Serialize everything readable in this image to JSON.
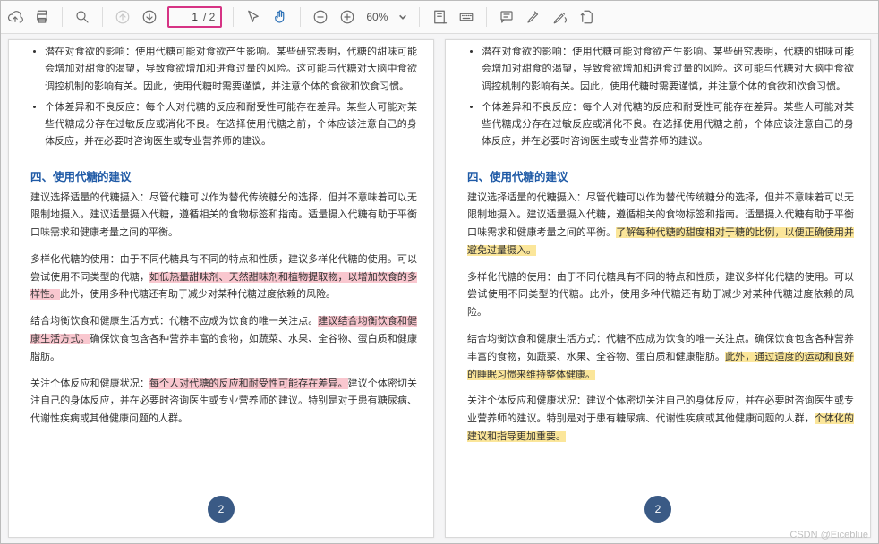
{
  "toolbar": {
    "page_current": "1",
    "page_total": "/ 2",
    "zoom": "60%"
  },
  "watermark": "CSDN @Eiceblue",
  "page_number": "2",
  "left": {
    "bullet1": "潜在对食欲的影响：使用代糖可能对食欲产生影响。某些研究表明，代糖的甜味可能会增加对甜食的渴望，导致食欲增加和进食过量的风险。这可能与代糖对大脑中食欲调控机制的影响有关。因此，使用代糖时需要谨慎，并注意个体的食欲和饮食习惯。",
    "bullet2": "个体差异和不良反应：每个人对代糖的反应和耐受性可能存在差异。某些人可能对某些代糖成分存在过敏反应或消化不良。在选择使用代糖之前，个体应该注意自己的身体反应，并在必要时咨询医生或专业营养师的建议。",
    "heading": "四、使用代糖的建议",
    "p1": "建议选择适量的代糖摄入：尽管代糖可以作为替代传统糖分的选择，但并不意味着可以无限制地摄入。建议适量摄入代糖，遵循相关的食物标签和指南。适量摄入代糖有助于平衡口味需求和健康考量之间的平衡。",
    "p2a": "多样化代糖的使用：由于不同代糖具有不同的特点和性质，建议多样化代糖的使用。可以尝试使用不同类型的代糖，",
    "p2_hl": "如低热量甜味剂、天然甜味剂和植物提取物，以增加饮食的多样性。",
    "p2b": "此外，使用多种代糖还有助于减少对某种代糖过度依赖的风险。",
    "p3a": "结合均衡饮食和健康生活方式：代糖不应成为饮食的唯一关注点。",
    "p3_hl": "建议结合均衡饮食和健康生活方式。",
    "p3b": "确保饮食包含各种营养丰富的食物，如蔬菜、水果、全谷物、蛋白质和健康脂肪。",
    "p4a": "关注个体反应和健康状况：",
    "p4_hl": "每个人对代糖的反应和耐受性可能存在差异。",
    "p4b": "建议个体密切关注自己的身体反应，并在必要时咨询医生或专业营养师的建议。特别是对于患有糖尿病、代谢性疾病或其他健康问题的人群。"
  },
  "right": {
    "bullet1": "潜在对食欲的影响：使用代糖可能对食欲产生影响。某些研究表明，代糖的甜味可能会增加对甜食的渴望，导致食欲增加和进食过量的风险。这可能与代糖对大脑中食欲调控机制的影响有关。因此，使用代糖时需要谨慎，并注意个体的食欲和饮食习惯。",
    "bullet2": "个体差异和不良反应：每个人对代糖的反应和耐受性可能存在差异。某些人可能对某些代糖成分存在过敏反应或消化不良。在选择使用代糖之前，个体应该注意自己的身体反应，并在必要时咨询医生或专业营养师的建议。",
    "heading": "四、使用代糖的建议",
    "p1a": "建议选择适量的代糖摄入：尽管代糖可以作为替代传统糖分的选择，但并不意味着可以无限制地摄入。建议适量摄入代糖，遵循相关的食物标签和指南。适量摄入代糖有助于平衡口味需求和健康考量之间的平衡。",
    "p1_hl": "了解每种代糖的甜度相对于糖的比例，以便正确使用并避免过量摄入。",
    "p2": "多样化代糖的使用：由于不同代糖具有不同的特点和性质，建议多样化代糖的使用。可以尝试使用不同类型的代糖。此外，使用多种代糖还有助于减少对某种代糖过度依赖的风险。",
    "p3a": "结合均衡饮食和健康生活方式：代糖不应成为饮食的唯一关注点。确保饮食包含各种营养丰富的食物，如蔬菜、水果、全谷物、蛋白质和健康脂肪。",
    "p3_hl": "此外，通过适度的运动和良好的睡眠习惯来维持整体健康。",
    "p4a": "关注个体反应和健康状况：建议个体密切关注自己的身体反应，并在必要时咨询医生或专业营养师的建议。特别是对于患有糖尿病、代谢性疾病或其他健康问题的人群，",
    "p4_hl": "个体化的建议和指导更加重要。"
  }
}
